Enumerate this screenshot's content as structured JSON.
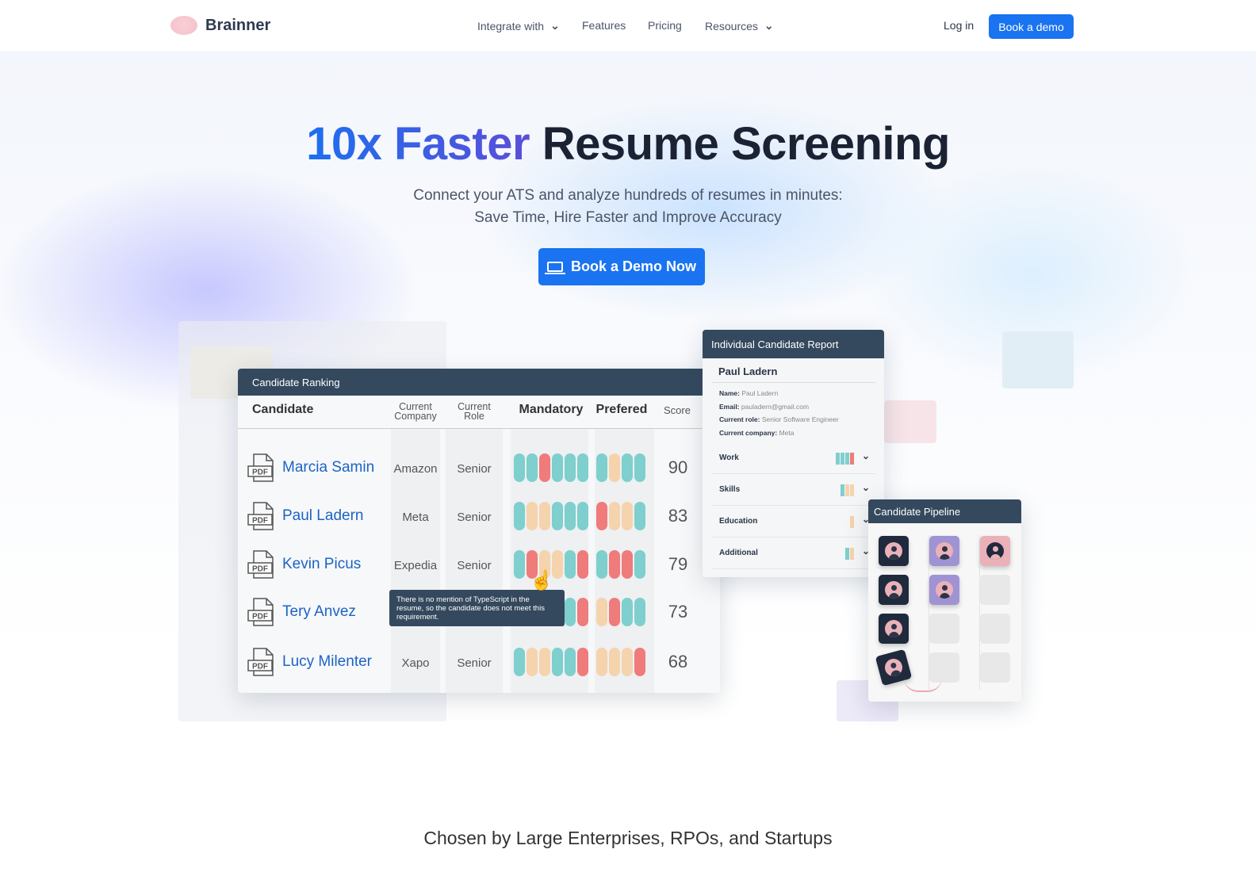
{
  "nav": {
    "brand": "Brainner",
    "links": [
      {
        "label": "Integrate with",
        "dropdown": true
      },
      {
        "label": "Features"
      },
      {
        "label": "Pricing"
      },
      {
        "label": "Resources",
        "dropdown": true
      }
    ],
    "login": "Log in",
    "book": "Book a demo"
  },
  "hero": {
    "title_highlight": "10x Faster",
    "title_rest": "Resume Screening",
    "subtitle_1": "Connect your ATS and analyze hundreds of resumes in minutes:",
    "subtitle_2": "Save Time, Hire Faster and Improve Accuracy",
    "cta": "Book a Demo Now"
  },
  "colors": {
    "accent": "#1a73f0",
    "header": "#34495e",
    "match": "#7ecfcd",
    "miss": "#ef7b7b",
    "partial": "#f5d3ad"
  },
  "ranking": {
    "title": "Candidate Ranking",
    "headers": {
      "candidate": "Candidate",
      "company": "Current Company",
      "role": "Current Role",
      "mandatory": "Mandatory",
      "preferred": "Prefered",
      "score": "Score"
    },
    "rows": [
      {
        "name": "Marcia Samin",
        "company": "Amazon",
        "role": "Senior",
        "mandatory": [
          "match",
          "match",
          "miss",
          "match",
          "match",
          "match"
        ],
        "preferred": [
          "match",
          "partial",
          "match",
          "match"
        ],
        "score": "90"
      },
      {
        "name": "Paul Ladern",
        "company": "Meta",
        "role": "Senior",
        "mandatory": [
          "match",
          "partial",
          "partial",
          "match",
          "match",
          "match"
        ],
        "preferred": [
          "miss",
          "partial",
          "partial",
          "match"
        ],
        "score": "83"
      },
      {
        "name": "Kevin Picus",
        "company": "Expedia",
        "role": "Senior",
        "mandatory": [
          "match",
          "miss",
          "partial",
          "partial",
          "match",
          "miss"
        ],
        "preferred": [
          "match",
          "miss",
          "miss",
          "match"
        ],
        "score": "79"
      },
      {
        "name": "Tery Anvez",
        "company": "",
        "role": "",
        "mandatory": [
          "match",
          "match",
          "match",
          "match",
          "match",
          "miss"
        ],
        "preferred": [
          "partial",
          "miss",
          "match",
          "match"
        ],
        "score": "73"
      },
      {
        "name": "Lucy Milenter",
        "company": "Xapo",
        "role": "Senior",
        "mandatory": [
          "match",
          "partial",
          "partial",
          "match",
          "match",
          "miss"
        ],
        "preferred": [
          "partial",
          "partial",
          "partial",
          "miss"
        ],
        "score": "68"
      }
    ],
    "pdf_label": "PDF",
    "tooltip": "There is no mention of TypeScript in the resume, so the candidate does not meet this requirement."
  },
  "report": {
    "title": "Individual Candidate Report",
    "name": "Paul Ladern",
    "fields": [
      {
        "label": "Name:",
        "value": "Paul Ladern"
      },
      {
        "label": "Email:",
        "value": "pauladern@gmail.com"
      },
      {
        "label": "Current role:",
        "value": "Senior Software Engineer"
      },
      {
        "label": "Current company:",
        "value": "Meta"
      }
    ],
    "sections": [
      {
        "label": "Work",
        "bars": [
          "match",
          "match",
          "match",
          "miss"
        ]
      },
      {
        "label": "Skills",
        "bars": [
          "match",
          "partial",
          "partial"
        ]
      },
      {
        "label": "Education",
        "bars": [
          "partial"
        ]
      },
      {
        "label": "Additional",
        "bars": [
          "match",
          "partial"
        ]
      }
    ]
  },
  "pipeline": {
    "title": "Candidate Pipeline",
    "columns": [
      [
        "dark",
        "dark",
        "dark",
        "dark"
      ],
      [
        "purple",
        "purple",
        "empty",
        "empty"
      ],
      [
        "pink",
        "empty",
        "empty",
        "empty"
      ]
    ]
  },
  "chosen": "Chosen by Large Enterprises, RPOs, and Startups"
}
